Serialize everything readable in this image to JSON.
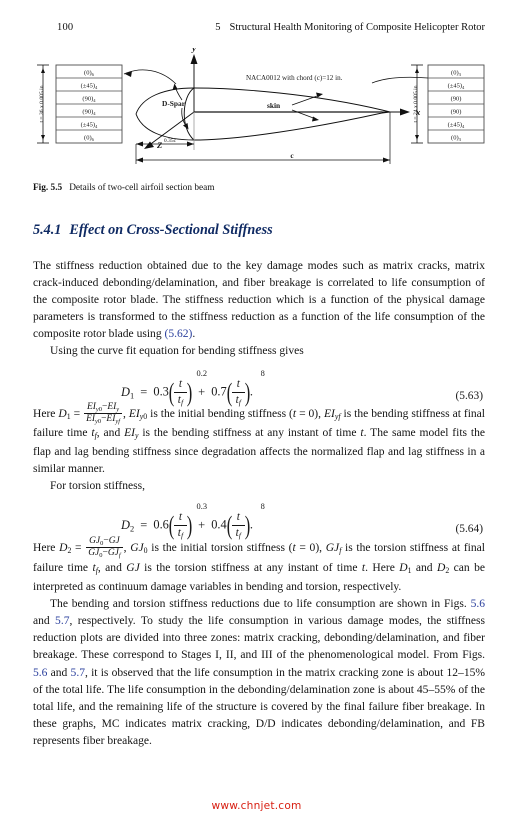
{
  "page": {
    "folio": "100",
    "running_head": {
      "chapter_number": "5",
      "title": "Structural Health Monitoring of Composite Helicopter Rotor"
    }
  },
  "figure": {
    "caption_label": "Fig. 5.5",
    "caption_text": "Details of two-cell airfoil section beam",
    "axis_y": "y",
    "axis_x": "x",
    "axis_z": "Z",
    "annotation_airfoil": "NACA0012  with chord (c)=12 in.",
    "label_dspar": "D-Spar",
    "label_skin": "skin",
    "dim_chord": "c",
    "dim_spar": "0.35c",
    "left_stack": {
      "thickness_label": "t = 36 x 0.005 in",
      "plies": [
        {
          "angle": "(0)",
          "sub": "6"
        },
        {
          "angle": "(±45)",
          "sub": "4"
        },
        {
          "angle": "(90)",
          "sub": "4"
        },
        {
          "angle": "(90)",
          "sub": "4"
        },
        {
          "angle": "(±45)",
          "sub": "4"
        },
        {
          "angle": "(0)",
          "sub": "6"
        }
      ]
    },
    "right_stack": {
      "thickness_label": "t = 24  x 0.005 in",
      "plies": [
        {
          "angle": "(0)",
          "sub": "3"
        },
        {
          "angle": "(±45)",
          "sub": "4"
        },
        {
          "angle": "(90)",
          "sub": ""
        },
        {
          "angle": "(90)",
          "sub": ""
        },
        {
          "angle": "(±45)",
          "sub": "4"
        },
        {
          "angle": "(0)",
          "sub": "3"
        }
      ]
    }
  },
  "section": {
    "number": "5.4.1",
    "title": "Effect on Cross-Sectional Stiffness"
  },
  "equations": {
    "eq563": {
      "tag": "(5.63)",
      "lhs": "D",
      "lhs_sub": "1",
      "coef1": "0.3",
      "exp1": "0.2",
      "coef2": "0.7",
      "exp2": "8",
      "num": "t",
      "den": "t",
      "den_sub": "f"
    },
    "eq564": {
      "tag": "(5.64)",
      "lhs": "D",
      "lhs_sub": "2",
      "coef1": "0.6",
      "exp1": "0.3",
      "coef2": "0.4",
      "exp2": "8",
      "num": "t",
      "den": "t",
      "den_sub": "f"
    }
  },
  "body": {
    "p1_a": "The stiffness reduction obtained due to the key damage modes such as matrix cracks, matrix crack-induced debonding/delamination, and fiber breakage is correlated to life consumption of the composite rotor blade. The stiffness reduction which is a function of the physical damage parameters is transformed to the stiffness reduction as a function of the life consumption of the composite rotor blade using ",
    "p1_link": "(5.62)",
    "p1_b": ".",
    "p2": "Using the curve fit equation for bending stiffness gives",
    "p3_a": "Here ",
    "p3_b": " is the initial bending stiffness (",
    "p3_c": " is the bending stiffness at final failure time ",
    "p3_d": " is the bending stiffness at any instant of time ",
    "p3_e": ". The same model fits the flap and lag bending stiffness since degradation affects the normalized flap and lag stiffness in a similar manner.",
    "p4": "For torsion stiffness,",
    "p5_a": "Here ",
    "p5_b": " is the initial torsion stiffness (",
    "p5_c": " is the torsion stiffness at final failure time ",
    "p5_d": " is the torsion stiffness at any instant of time ",
    "p5_e": " can be interpreted as continuum damage variables in bending and torsion, respectively.",
    "p6_a": "The bending and torsion stiffness reductions due to life consumption are shown in Figs. ",
    "p6_link1": "5.6",
    "p6_b": " and ",
    "p6_link2": "5.7",
    "p6_c": ", respectively. To study the life consumption in various damage modes, the stiffness reduction plots are divided into three zones: matrix cracking, debonding/delamination, and fiber breakage. These correspond to Stages I, II, and III of the phenomenological model. From Figs. ",
    "p6_link3": "5.6",
    "p6_d": " and ",
    "p6_link4": "5.7",
    "p6_e": ", it is observed that the life consumption in the matrix cracking zone is about 12–15% of the total life. The life consumption in the debonding/delamination zone is about 45–55% of the total life, and the remaining life of the structure is covered by the final failure fiber breakage. In these graphs, MC indicates matrix cracking, D/D indicates debonding/delamination, and FB represents fiber breakage."
  },
  "watermark": "www.chnjet.com",
  "colors": {
    "link": "#2a3f9d",
    "heading": "#0f2a63",
    "watermark": "#d81f12",
    "text": "#141414"
  }
}
